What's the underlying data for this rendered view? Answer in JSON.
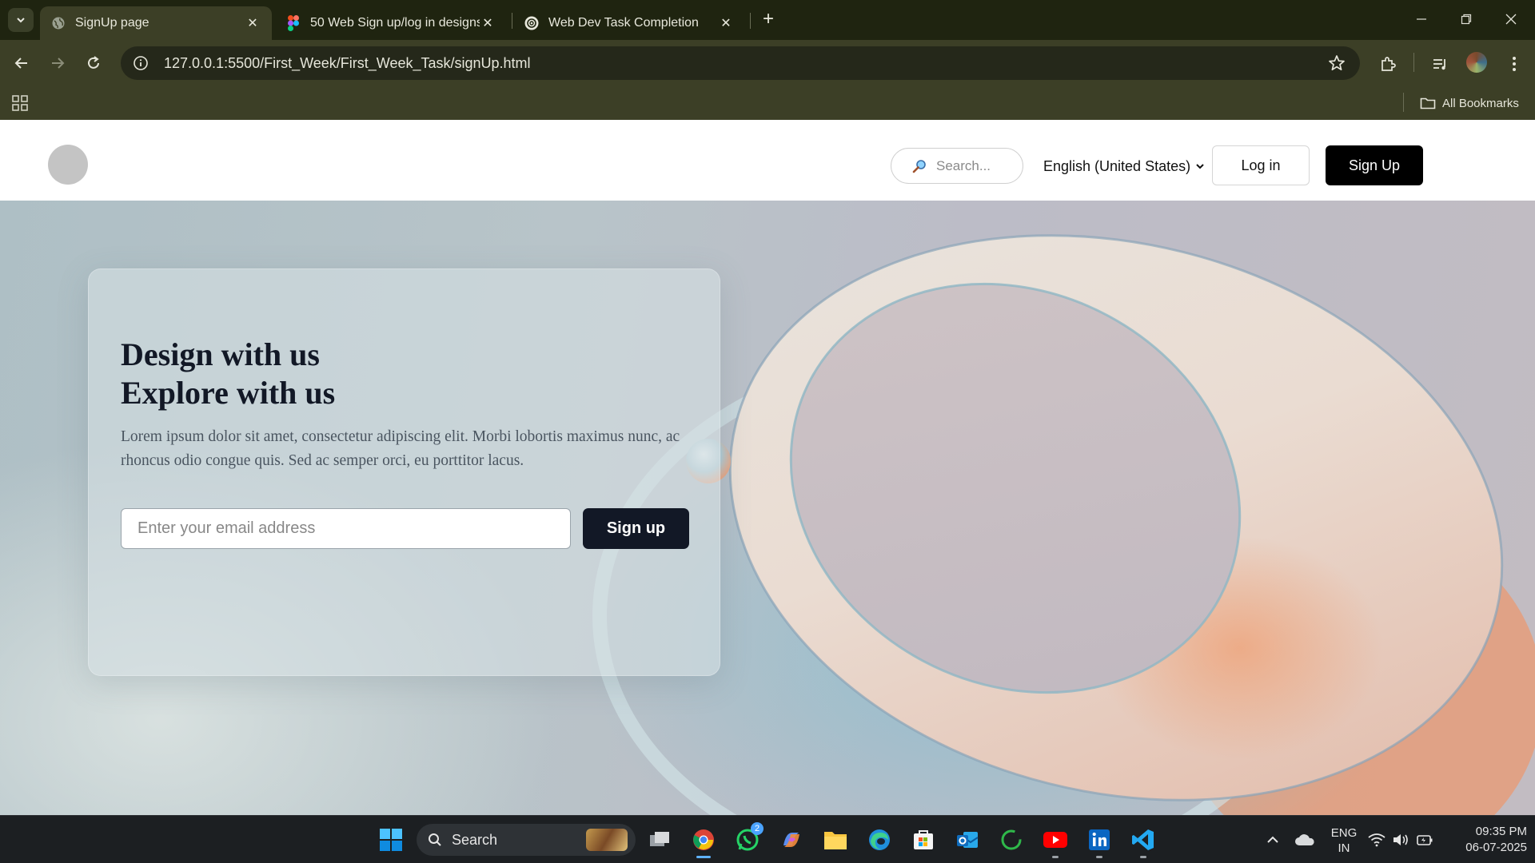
{
  "browser": {
    "tabs": [
      {
        "title": "SignUp page",
        "favicon": "globe-icon",
        "active": true
      },
      {
        "title": "50 Web Sign up/log in designs",
        "favicon": "figma-icon",
        "active": false
      },
      {
        "title": "Web Dev Task Completion",
        "favicon": "openai-icon",
        "active": false
      }
    ],
    "url": "127.0.0.1:5500/First_Week/First_Week_Task/signUp.html",
    "bookmarks_label": "All Bookmarks"
  },
  "site": {
    "search_placeholder": "Search...",
    "language": "English (United States)",
    "login_label": "Log in",
    "signup_label": "Sign Up"
  },
  "hero": {
    "heading_line1": "Design with us",
    "heading_line2": "Explore with us",
    "description": "Lorem ipsum dolor sit amet, consectetur adipiscing elit. Morbi lobortis maximus nunc, ac rhoncus odio congue quis. Sed ac semper orci, eu porttitor lacus.",
    "email_placeholder": "Enter your email address",
    "signup_button": "Sign up"
  },
  "taskbar": {
    "search_label": "Search",
    "whatsapp_badge": "2",
    "lang_line1": "ENG",
    "lang_line2": "IN",
    "time": "09:35 PM",
    "date": "06-07-2025"
  },
  "colors": {
    "chrome_bg": "#3c3f26",
    "tabstrip_bg": "#1f2410",
    "dark_button": "#121826",
    "accent_blue": "#5fb2ff"
  }
}
